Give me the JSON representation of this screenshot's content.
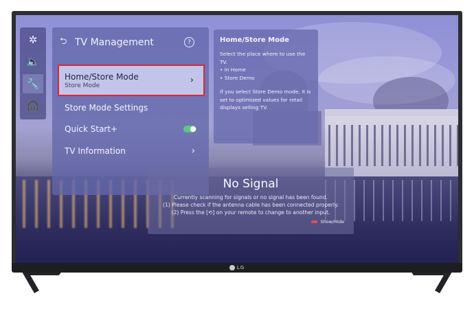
{
  "panel": {
    "title": "TV Management",
    "back_icon": "back-arrow-icon",
    "help_icon": "?",
    "items": [
      {
        "label": "Home/Store Mode",
        "sub": "Store Mode",
        "chevron": "›",
        "selected": true
      },
      {
        "label": "Store Mode Settings"
      },
      {
        "label": "Quick Start+",
        "toggle": "on"
      },
      {
        "label": "TV Information",
        "chevron": "›"
      }
    ]
  },
  "sidebar": {
    "icons": [
      "picture-icon",
      "sound-icon",
      "settings-wrench-icon",
      "support-headset-icon"
    ],
    "glyphs": [
      "✲",
      "🔈",
      "🔧",
      "🎧"
    ]
  },
  "info": {
    "title": "Home/Store Mode",
    "line1": "Select the place where to use the TV.",
    "opt1": "• In Home",
    "opt2": "• Store Demo",
    "desc": "If you select Store Demo mode, it is set to optimized values for retail displays selling TV."
  },
  "nosignal": {
    "title": "No Signal",
    "line1": "Currently scanning for signals or no signal has been found.",
    "line2": "(1) Please check if the antenna cable has been connected properly.",
    "line3": "(2) Press the [⟲] on your remote to change to another input.",
    "hide_label": "Show/Hide"
  },
  "brand": {
    "logo_text": "LG"
  },
  "colors": {
    "selection_border": "#d42a3a",
    "toggle_on": "#5ec58a"
  }
}
